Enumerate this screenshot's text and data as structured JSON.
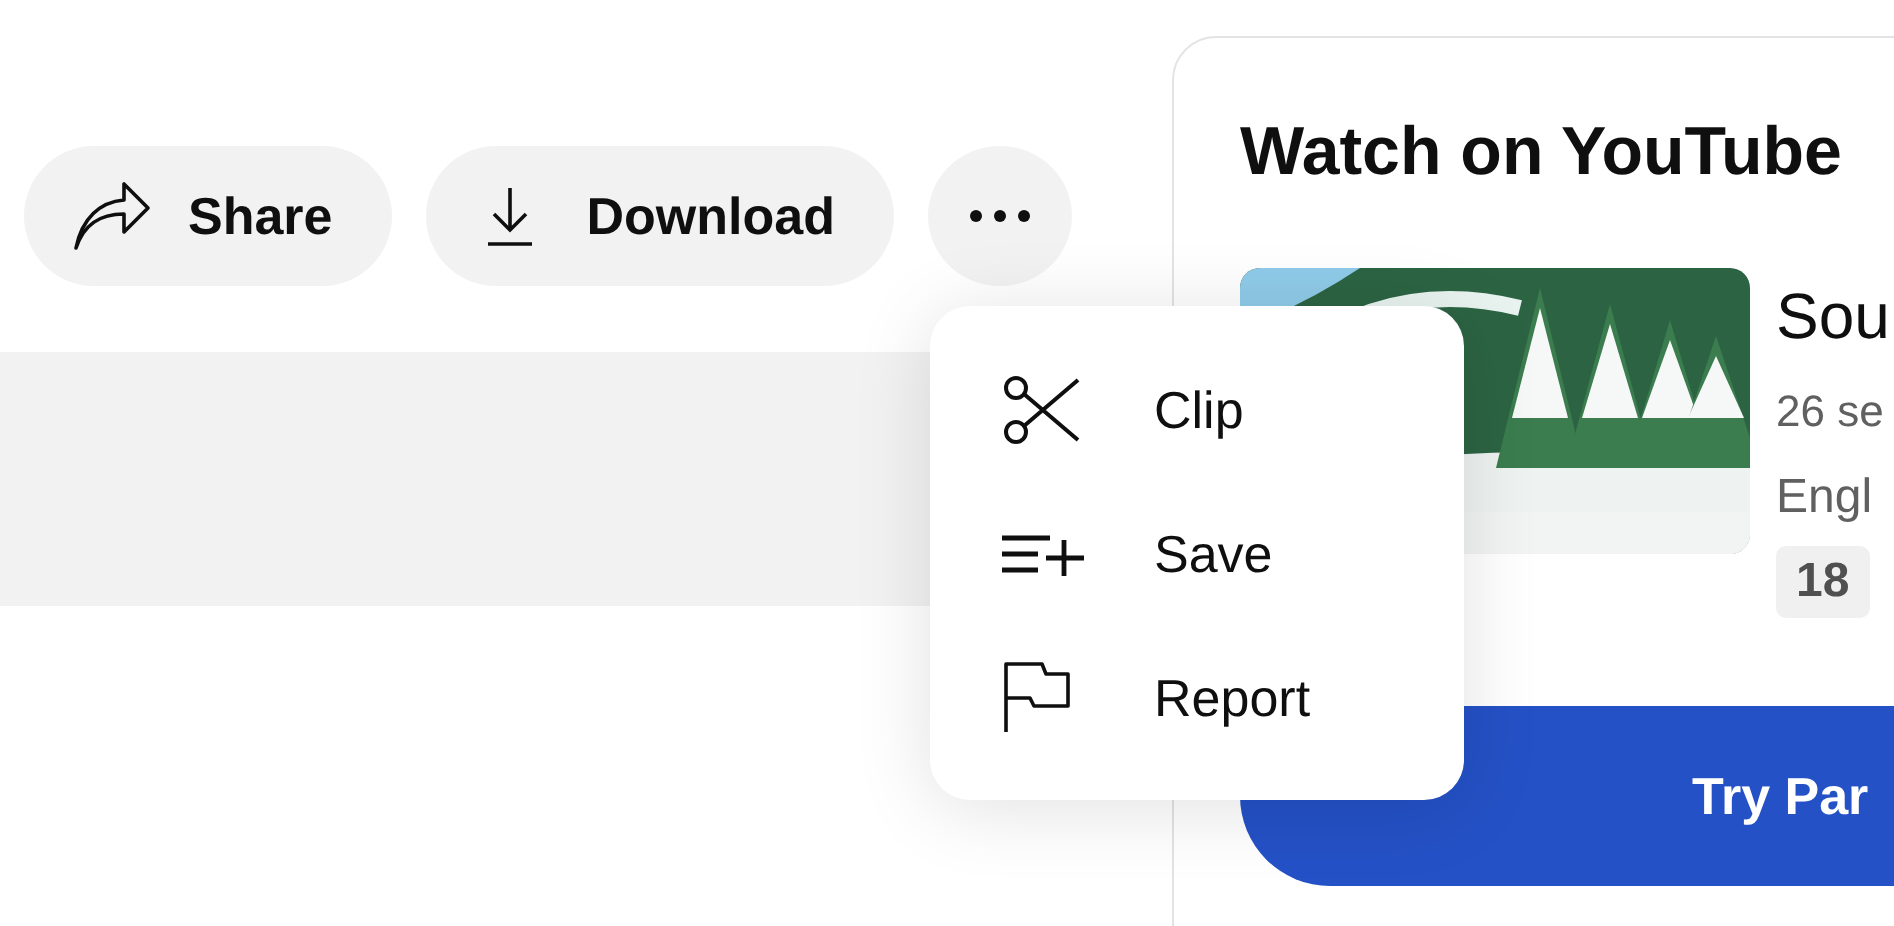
{
  "actions": [
    {
      "kind": "share",
      "label": "Share"
    },
    {
      "kind": "download",
      "label": "Download"
    },
    {
      "kind": "more"
    }
  ],
  "menu": [
    {
      "kind": "clip",
      "label": "Clip"
    },
    {
      "kind": "save",
      "label": "Save"
    },
    {
      "kind": "report",
      "label": "Report"
    }
  ],
  "panel": {
    "title": "Watch on YouTube",
    "card": {
      "title": "Sou",
      "seasons": "26 se",
      "language": "Engl",
      "rating": "18"
    },
    "button": "Try Par"
  }
}
